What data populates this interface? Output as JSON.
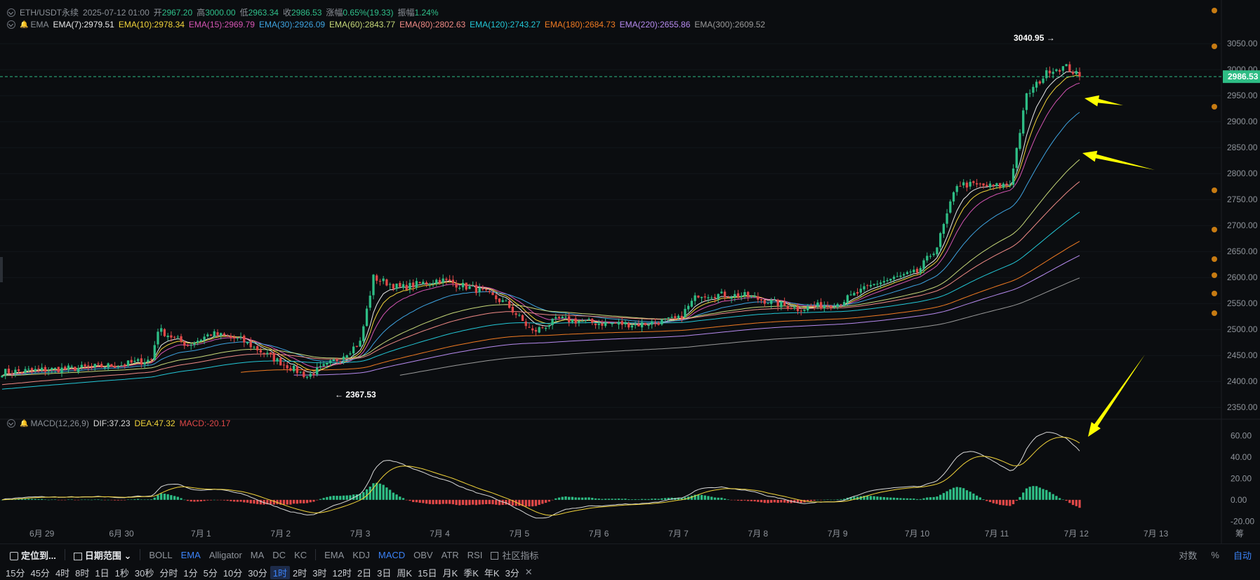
{
  "header": {
    "symbol": "ETH/USDT永续",
    "datetime": "2025-07-12 01:00",
    "open_label": "开",
    "open": "2967.20",
    "high_label": "高",
    "high": "3000.00",
    "low_label": "低",
    "low": "2963.34",
    "close_label": "收",
    "close": "2986.53",
    "change_label": "涨幅",
    "change": "0.65%(19.33)",
    "amp_label": "振幅",
    "amp": "1.24%"
  },
  "ema_legend": {
    "name": "EMA",
    "items": [
      {
        "label": "EMA(7):2979.51",
        "color": "#e8e8e8"
      },
      {
        "label": "EMA(10):2978.34",
        "color": "#f2d43a"
      },
      {
        "label": "EMA(15):2969.79",
        "color": "#d655b4"
      },
      {
        "label": "EMA(30):2926.09",
        "color": "#3ea3e0"
      },
      {
        "label": "EMA(60):2843.77",
        "color": "#c6d879"
      },
      {
        "label": "EMA(80):2802.63",
        "color": "#f08a86"
      },
      {
        "label": "EMA(120):2743.27",
        "color": "#23c7d6"
      },
      {
        "label": "EMA(180):2684.73",
        "color": "#f07b22"
      },
      {
        "label": "EMA(220):2655.86",
        "color": "#b78bf0"
      },
      {
        "label": "EMA(300):2609.52",
        "color": "#9a9a9a"
      }
    ]
  },
  "macd_legend": {
    "name": "MACD(12,26,9)",
    "dif": "DIF:37.23",
    "dea": "DEA:47.32",
    "macd": "MACD:-20.17"
  },
  "price_axis": {
    "ticks": [
      "3050.00",
      "3000.00",
      "2950.00",
      "2900.00",
      "2850.00",
      "2800.00",
      "2750.00",
      "2700.00",
      "2650.00",
      "2600.00",
      "2550.00",
      "2500.00",
      "2450.00",
      "2400.00",
      "2350.00"
    ],
    "current_price": "2986.53"
  },
  "macd_axis": {
    "ticks": [
      "60.00",
      "40.00",
      "20.00",
      "0.00",
      "-20.00"
    ]
  },
  "time_axis": {
    "ticks": [
      "6月 29",
      "6月 30",
      "7月 1",
      "7月 2",
      "7月 3",
      "7月 4",
      "7月 5",
      "7月 6",
      "7月 7",
      "7月 8",
      "7月 9",
      "7月 10",
      "7月 11",
      "7月 12",
      "7月 13"
    ]
  },
  "annotations": {
    "high": "3040.95",
    "low": "2367.53"
  },
  "chart_data": {
    "type": "candlestick",
    "interval": "1时",
    "x_range": [
      "2025-06-28 12:00",
      "2025-07-12 01:00"
    ],
    "ylim": [
      2330,
      3080
    ],
    "macd_ylim": [
      -25,
      70
    ],
    "trend_anchors_close": [
      [
        "6/28 12:00",
        2418
      ],
      [
        "6/29 12:00",
        2426
      ],
      [
        "6/30 00:00",
        2432
      ],
      [
        "6/30 09:00",
        2442
      ],
      [
        "6/30 11:00",
        2500
      ],
      [
        "6/30 20:00",
        2470
      ],
      [
        "7/1 03:00",
        2492
      ],
      [
        "7/1 12:00",
        2480
      ],
      [
        "7/1 23:00",
        2440
      ],
      [
        "7/2 08:00",
        2410
      ],
      [
        "7/2 17:00",
        2442
      ],
      [
        "7/3 00:00",
        2475
      ],
      [
        "7/3 04:00",
        2600
      ],
      [
        "7/3 12:00",
        2580
      ],
      [
        "7/4 00:00",
        2596
      ],
      [
        "7/4 12:00",
        2575
      ],
      [
        "7/4 20:00",
        2550
      ],
      [
        "7/5 04:00",
        2495
      ],
      [
        "7/5 12:00",
        2520
      ],
      [
        "7/6 00:00",
        2512
      ],
      [
        "7/6 12:00",
        2510
      ],
      [
        "7/7 00:00",
        2520
      ],
      [
        "7/7 06:00",
        2568
      ],
      [
        "7/7 20:00",
        2565
      ],
      [
        "7/8 12:00",
        2540
      ],
      [
        "7/9 00:00",
        2550
      ],
      [
        "7/9 12:00",
        2590
      ],
      [
        "7/10 00:00",
        2610
      ],
      [
        "7/10 06:00",
        2660
      ],
      [
        "7/10 12:00",
        2780
      ],
      [
        "7/10 23:00",
        2775
      ],
      [
        "7/11 04:00",
        2780
      ],
      [
        "7/11 09:00",
        2950
      ],
      [
        "7/11 16:00",
        3000
      ],
      [
        "7/11 21:00",
        3005
      ],
      [
        "7/12 01:00",
        2986.53
      ]
    ],
    "ema_latest": {
      "EMA7": 2979.51,
      "EMA10": 2978.34,
      "EMA15": 2969.79,
      "EMA30": 2926.09,
      "EMA60": 2843.77,
      "EMA80": 2802.63,
      "EMA120": 2743.27,
      "EMA180": 2684.73,
      "EMA220": 2655.86,
      "EMA300": 2609.52
    },
    "macd_latest": {
      "DIF": 37.23,
      "DEA": 47.32,
      "MACD": -20.17
    }
  },
  "colors": {
    "up": "#2ebd85",
    "down": "#e04848",
    "dif": "#d9d9d9",
    "dea": "#f2d43a",
    "arrow": "#ffff00",
    "price_tag": "#2ebd85"
  },
  "toolbar": {
    "locate": "定位到...",
    "date_range": "日期范围",
    "main_indicators": [
      "BOLL",
      "EMA",
      "Alligator",
      "MA",
      "DC",
      "KC"
    ],
    "main_active": "EMA",
    "sub_indicators": [
      "EMA",
      "KDJ",
      "MACD",
      "OBV",
      "ATR",
      "RSI"
    ],
    "sub_active": "MACD",
    "community": "社区指标",
    "log_scale": "对数",
    "percent": "%",
    "auto": "自动"
  },
  "timeframes": {
    "items": [
      "15分",
      "45分",
      "4时",
      "8时",
      "1日",
      "1秒",
      "30秒",
      "分时",
      "1分",
      "5分",
      "10分",
      "30分",
      "1时",
      "2时",
      "3时",
      "12时",
      "2日",
      "3日",
      "周K",
      "15日",
      "月K",
      "季K",
      "年K",
      "3分"
    ],
    "active": "1时",
    "close_symbol": "✕"
  },
  "right_axis_extra": "筹"
}
